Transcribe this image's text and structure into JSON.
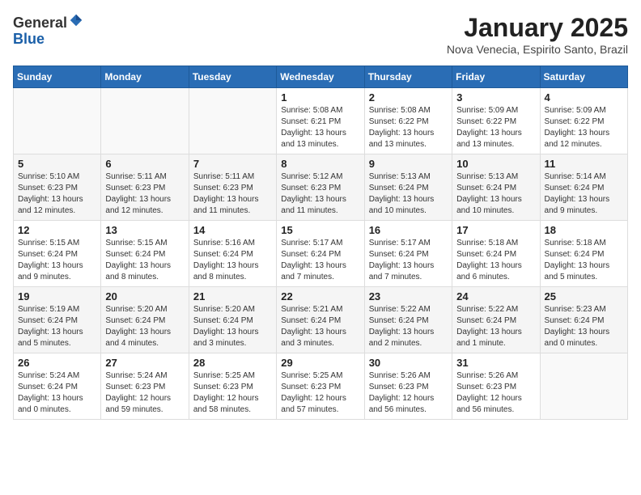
{
  "logo": {
    "general": "General",
    "blue": "Blue"
  },
  "header": {
    "month": "January 2025",
    "location": "Nova Venecia, Espirito Santo, Brazil"
  },
  "weekdays": [
    "Sunday",
    "Monday",
    "Tuesday",
    "Wednesday",
    "Thursday",
    "Friday",
    "Saturday"
  ],
  "weeks": [
    [
      {
        "day": "",
        "info": ""
      },
      {
        "day": "",
        "info": ""
      },
      {
        "day": "",
        "info": ""
      },
      {
        "day": "1",
        "info": "Sunrise: 5:08 AM\nSunset: 6:21 PM\nDaylight: 13 hours\nand 13 minutes."
      },
      {
        "day": "2",
        "info": "Sunrise: 5:08 AM\nSunset: 6:22 PM\nDaylight: 13 hours\nand 13 minutes."
      },
      {
        "day": "3",
        "info": "Sunrise: 5:09 AM\nSunset: 6:22 PM\nDaylight: 13 hours\nand 13 minutes."
      },
      {
        "day": "4",
        "info": "Sunrise: 5:09 AM\nSunset: 6:22 PM\nDaylight: 13 hours\nand 12 minutes."
      }
    ],
    [
      {
        "day": "5",
        "info": "Sunrise: 5:10 AM\nSunset: 6:23 PM\nDaylight: 13 hours\nand 12 minutes."
      },
      {
        "day": "6",
        "info": "Sunrise: 5:11 AM\nSunset: 6:23 PM\nDaylight: 13 hours\nand 12 minutes."
      },
      {
        "day": "7",
        "info": "Sunrise: 5:11 AM\nSunset: 6:23 PM\nDaylight: 13 hours\nand 11 minutes."
      },
      {
        "day": "8",
        "info": "Sunrise: 5:12 AM\nSunset: 6:23 PM\nDaylight: 13 hours\nand 11 minutes."
      },
      {
        "day": "9",
        "info": "Sunrise: 5:13 AM\nSunset: 6:24 PM\nDaylight: 13 hours\nand 10 minutes."
      },
      {
        "day": "10",
        "info": "Sunrise: 5:13 AM\nSunset: 6:24 PM\nDaylight: 13 hours\nand 10 minutes."
      },
      {
        "day": "11",
        "info": "Sunrise: 5:14 AM\nSunset: 6:24 PM\nDaylight: 13 hours\nand 9 minutes."
      }
    ],
    [
      {
        "day": "12",
        "info": "Sunrise: 5:15 AM\nSunset: 6:24 PM\nDaylight: 13 hours\nand 9 minutes."
      },
      {
        "day": "13",
        "info": "Sunrise: 5:15 AM\nSunset: 6:24 PM\nDaylight: 13 hours\nand 8 minutes."
      },
      {
        "day": "14",
        "info": "Sunrise: 5:16 AM\nSunset: 6:24 PM\nDaylight: 13 hours\nand 8 minutes."
      },
      {
        "day": "15",
        "info": "Sunrise: 5:17 AM\nSunset: 6:24 PM\nDaylight: 13 hours\nand 7 minutes."
      },
      {
        "day": "16",
        "info": "Sunrise: 5:17 AM\nSunset: 6:24 PM\nDaylight: 13 hours\nand 7 minutes."
      },
      {
        "day": "17",
        "info": "Sunrise: 5:18 AM\nSunset: 6:24 PM\nDaylight: 13 hours\nand 6 minutes."
      },
      {
        "day": "18",
        "info": "Sunrise: 5:18 AM\nSunset: 6:24 PM\nDaylight: 13 hours\nand 5 minutes."
      }
    ],
    [
      {
        "day": "19",
        "info": "Sunrise: 5:19 AM\nSunset: 6:24 PM\nDaylight: 13 hours\nand 5 minutes."
      },
      {
        "day": "20",
        "info": "Sunrise: 5:20 AM\nSunset: 6:24 PM\nDaylight: 13 hours\nand 4 minutes."
      },
      {
        "day": "21",
        "info": "Sunrise: 5:20 AM\nSunset: 6:24 PM\nDaylight: 13 hours\nand 3 minutes."
      },
      {
        "day": "22",
        "info": "Sunrise: 5:21 AM\nSunset: 6:24 PM\nDaylight: 13 hours\nand 3 minutes."
      },
      {
        "day": "23",
        "info": "Sunrise: 5:22 AM\nSunset: 6:24 PM\nDaylight: 13 hours\nand 2 minutes."
      },
      {
        "day": "24",
        "info": "Sunrise: 5:22 AM\nSunset: 6:24 PM\nDaylight: 13 hours\nand 1 minute."
      },
      {
        "day": "25",
        "info": "Sunrise: 5:23 AM\nSunset: 6:24 PM\nDaylight: 13 hours\nand 0 minutes."
      }
    ],
    [
      {
        "day": "26",
        "info": "Sunrise: 5:24 AM\nSunset: 6:24 PM\nDaylight: 13 hours\nand 0 minutes."
      },
      {
        "day": "27",
        "info": "Sunrise: 5:24 AM\nSunset: 6:23 PM\nDaylight: 12 hours\nand 59 minutes."
      },
      {
        "day": "28",
        "info": "Sunrise: 5:25 AM\nSunset: 6:23 PM\nDaylight: 12 hours\nand 58 minutes."
      },
      {
        "day": "29",
        "info": "Sunrise: 5:25 AM\nSunset: 6:23 PM\nDaylight: 12 hours\nand 57 minutes."
      },
      {
        "day": "30",
        "info": "Sunrise: 5:26 AM\nSunset: 6:23 PM\nDaylight: 12 hours\nand 56 minutes."
      },
      {
        "day": "31",
        "info": "Sunrise: 5:26 AM\nSunset: 6:23 PM\nDaylight: 12 hours\nand 56 minutes."
      },
      {
        "day": "",
        "info": ""
      }
    ]
  ]
}
